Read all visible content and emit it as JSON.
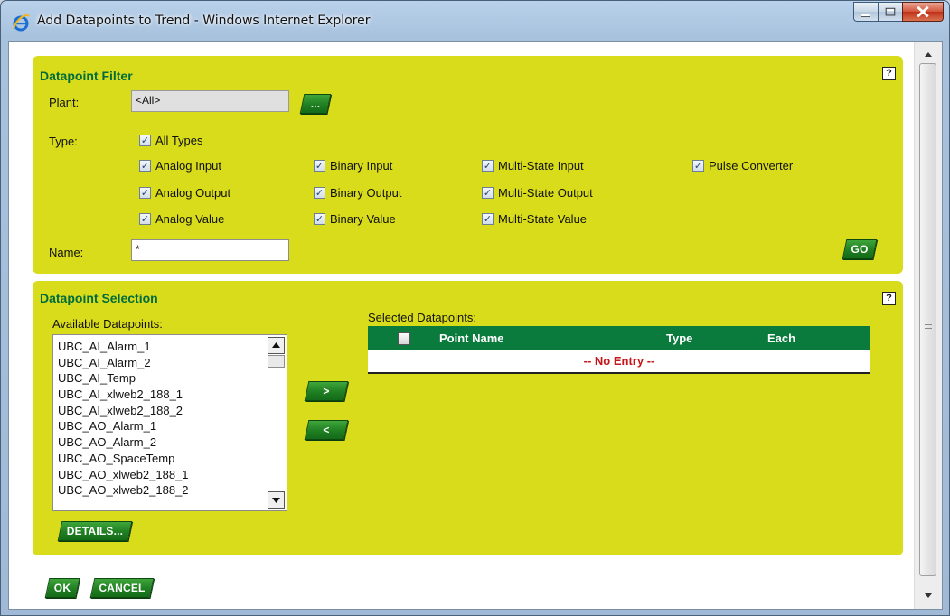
{
  "window": {
    "title": "Add Datapoints to Trend - Windows Internet Explorer"
  },
  "filter": {
    "title": "Datapoint Filter",
    "help": "?",
    "plant_label": "Plant:",
    "plant_value": "<All>",
    "browse_button": "...",
    "type_label": "Type:",
    "types": [
      {
        "label": "All Types",
        "checked": true
      },
      {
        "label": "Analog Input",
        "checked": true
      },
      {
        "label": "Binary Input",
        "checked": true
      },
      {
        "label": "Multi-State Input",
        "checked": true
      },
      {
        "label": "Pulse Converter",
        "checked": true
      },
      {
        "label": "Analog Output",
        "checked": true
      },
      {
        "label": "Binary Output",
        "checked": true
      },
      {
        "label": "Multi-State Output",
        "checked": true
      },
      {
        "label": "Analog Value",
        "checked": true
      },
      {
        "label": "Binary Value",
        "checked": true
      },
      {
        "label": "Multi-State Value",
        "checked": true
      }
    ],
    "name_label": "Name:",
    "name_value": "*",
    "go_button": "GO"
  },
  "selection": {
    "title": "Datapoint Selection",
    "help": "?",
    "available_label": "Available Datapoints:",
    "available": [
      "UBC_AI_Alarm_1",
      "UBC_AI_Alarm_2",
      "UBC_AI_Temp",
      "UBC_AI_xlweb2_188_1",
      "UBC_AI_xlweb2_188_2",
      "UBC_AO_Alarm_1",
      "UBC_AO_Alarm_2",
      "UBC_AO_SpaceTemp",
      "UBC_AO_xlweb2_188_1",
      "UBC_AO_xlweb2_188_2"
    ],
    "add_button": ">",
    "remove_button": "<",
    "details_button": "DETAILS...",
    "selected_label": "Selected Datapoints:",
    "columns": [
      "Point Name",
      "Type",
      "Each"
    ],
    "empty_text": "-- No Entry --"
  },
  "footer": {
    "ok_button": "OK",
    "cancel_button": "CANCEL"
  },
  "colors": {
    "panel": "#d9dc1b",
    "panel_title": "#006c3c",
    "button_green": "#1f7f22",
    "table_header": "#0a7a3d",
    "empty_text": "#c4171a"
  }
}
